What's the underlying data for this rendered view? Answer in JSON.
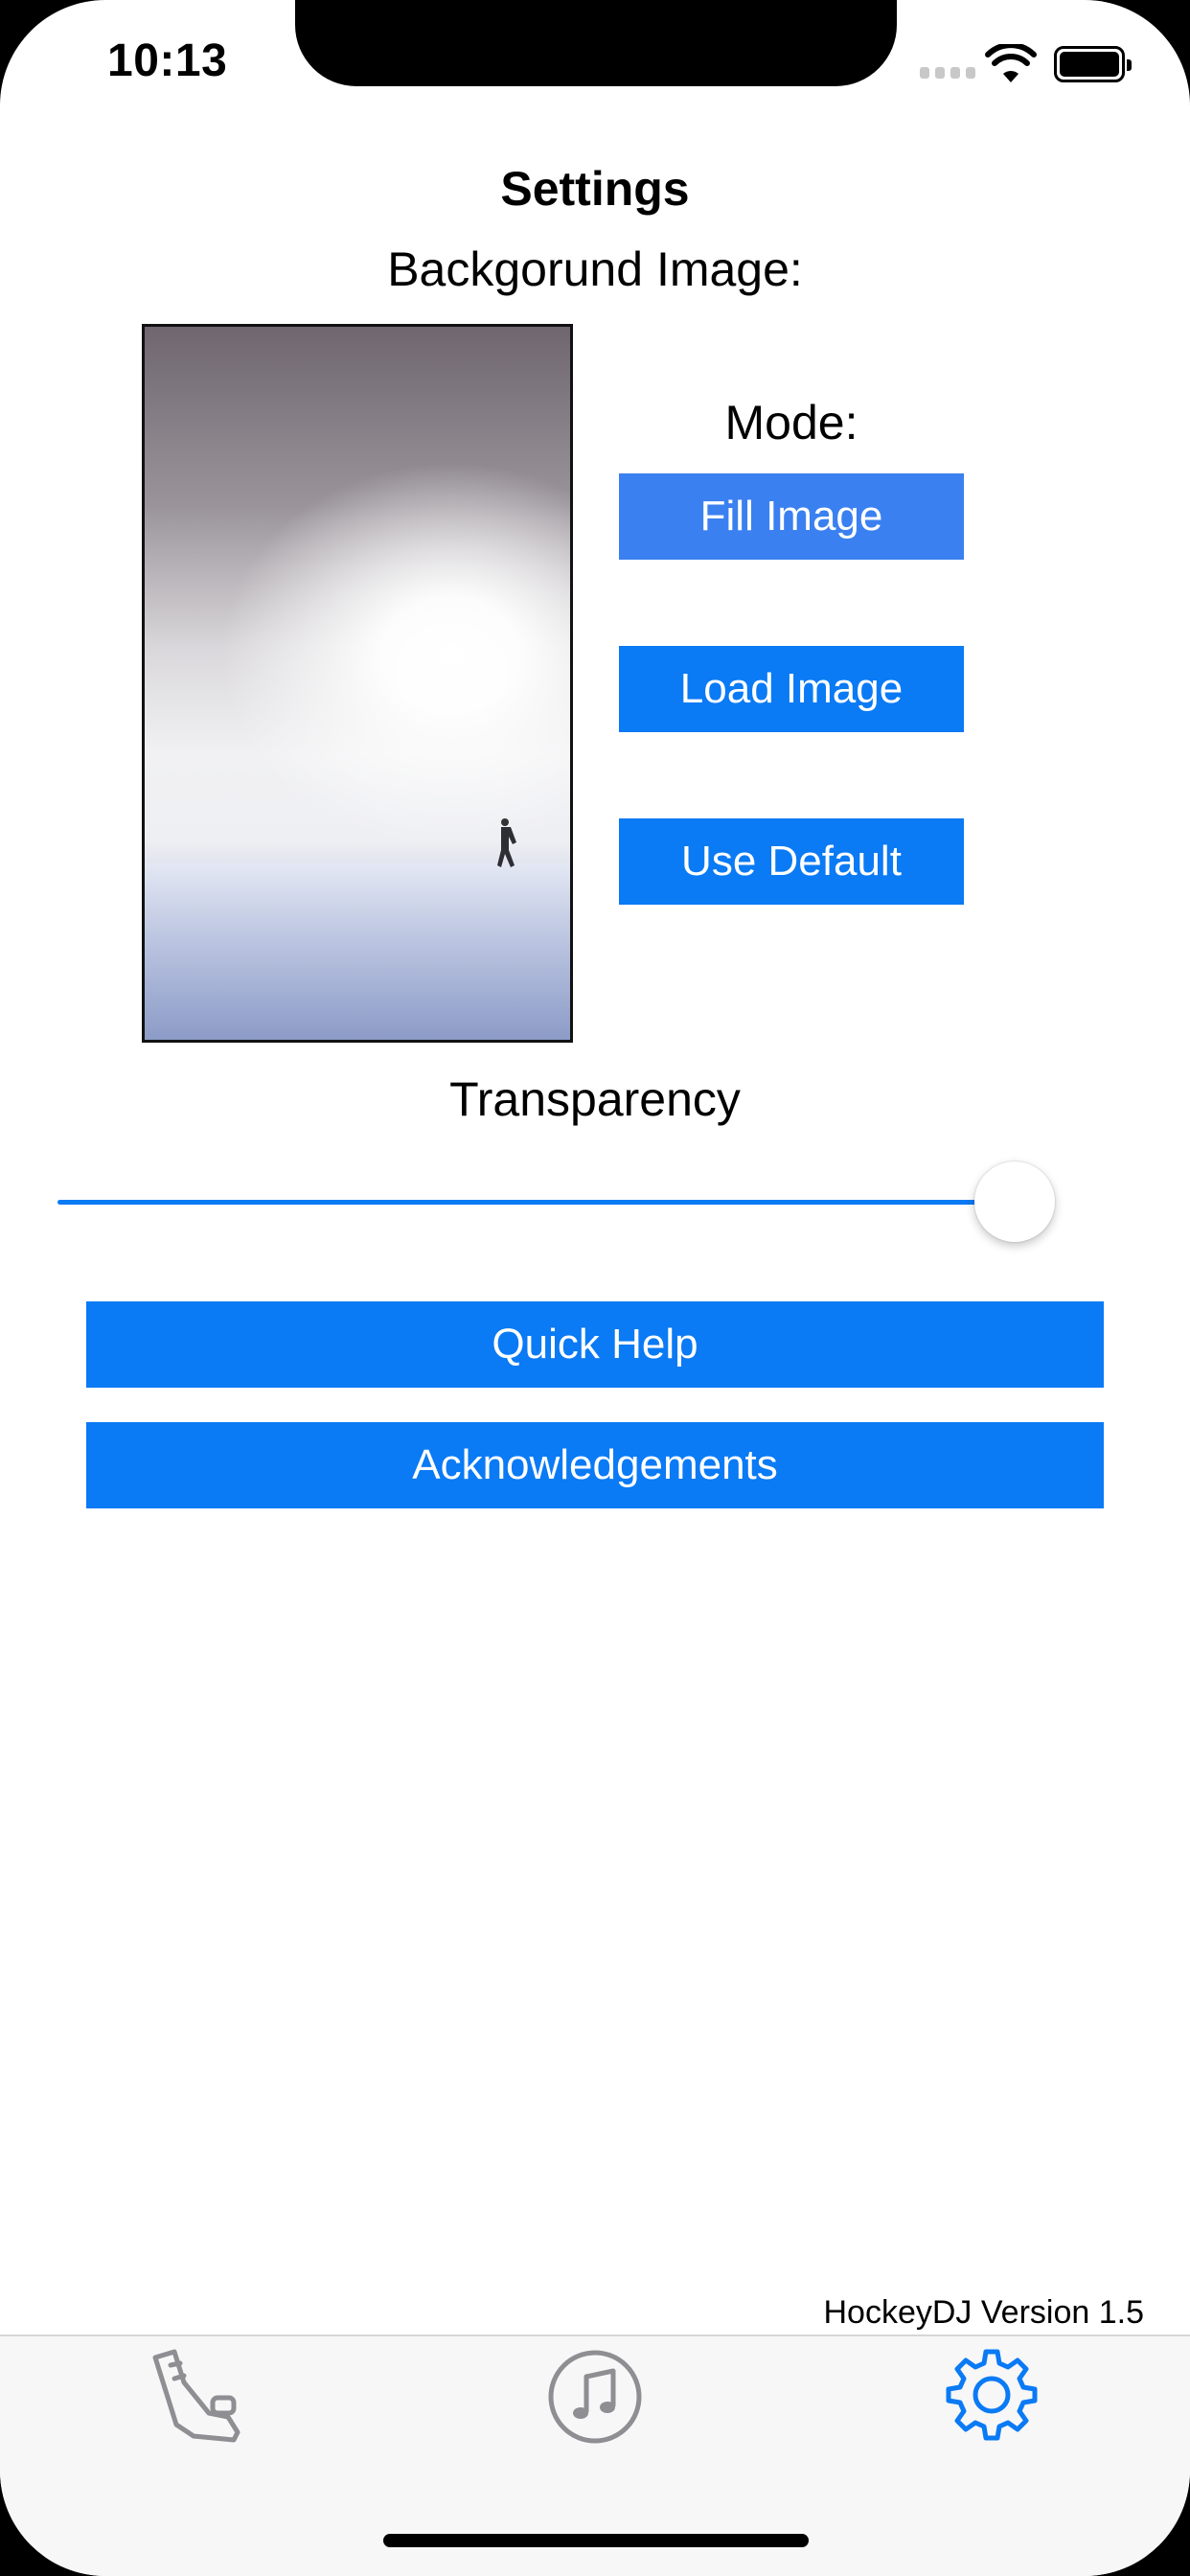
{
  "status_bar": {
    "time": "10:13"
  },
  "header": {
    "title": "Settings"
  },
  "background_image": {
    "label": "Backgorund Image:",
    "mode_label": "Mode:",
    "buttons": {
      "fill": "Fill Image",
      "load": "Load Image",
      "default": "Use Default"
    }
  },
  "transparency": {
    "label": "Transparency",
    "value": 0.92
  },
  "actions": {
    "quick_help": "Quick Help",
    "acknowledgements": "Acknowledgements"
  },
  "footer": {
    "version": "HockeyDJ Version 1.5"
  },
  "tabs": [
    {
      "icon": "skate-icon",
      "active": false
    },
    {
      "icon": "music-icon",
      "active": false
    },
    {
      "icon": "gear-icon",
      "active": true
    }
  ],
  "colors": {
    "accent": "#0a7af5",
    "fill_button": "#3a80f0",
    "inactive_tab": "#8e8e93"
  }
}
